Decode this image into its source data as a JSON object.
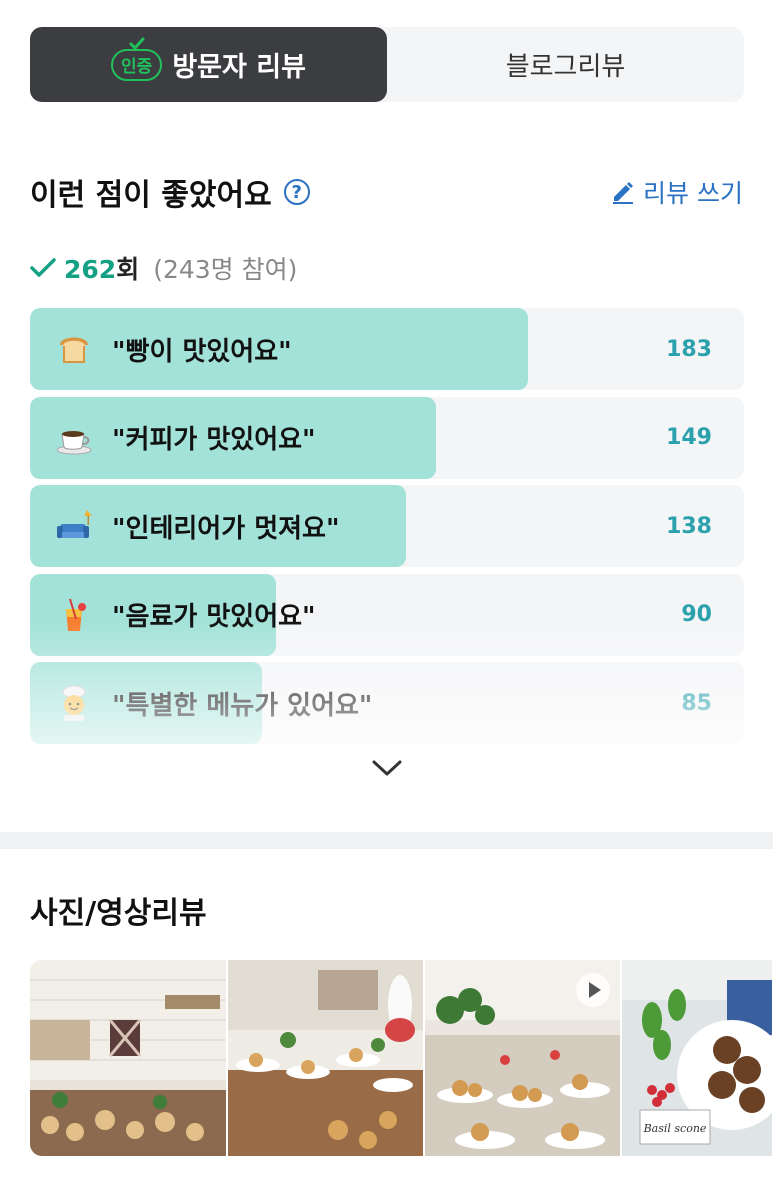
{
  "tabs": {
    "cert_badge": "인증",
    "visitor_review": "방문자 리뷰",
    "blog_review": "블로그리뷰"
  },
  "good_points": {
    "title": "이런 점이 좋았어요",
    "help_icon": "question-circle-icon",
    "write_review": "리뷰 쓰기",
    "summary": {
      "count": "262",
      "unit": "회",
      "participants": "(243명 참여)"
    },
    "items": [
      {
        "emoji": "bread",
        "label": "\"빵이 맛있어요\"",
        "count": "183",
        "ratio": 0.698
      },
      {
        "emoji": "coffee",
        "label": "\"커피가 맛있어요\"",
        "count": "149",
        "ratio": 0.569
      },
      {
        "emoji": "sofa",
        "label": "\"인테리어가 멋져요\"",
        "count": "138",
        "ratio": 0.527
      },
      {
        "emoji": "tropical-drink",
        "label": "\"음료가 맛있어요\"",
        "count": "90",
        "ratio": 0.344
      },
      {
        "emoji": "chef",
        "label": "\"특별한 메뉴가 있어요\"",
        "count": "85",
        "ratio": 0.325
      }
    ]
  },
  "photo_review": {
    "title": "사진/영상리뷰",
    "sign_text": "Basil scone"
  },
  "colors": {
    "tab_active_bg": "#3c3d40",
    "cert_green": "#20c15b",
    "link_blue": "#2a72c4",
    "count_teal": "#14a083",
    "bar_fill": "#a3e2d8",
    "bar_count": "#2aa1ad"
  }
}
